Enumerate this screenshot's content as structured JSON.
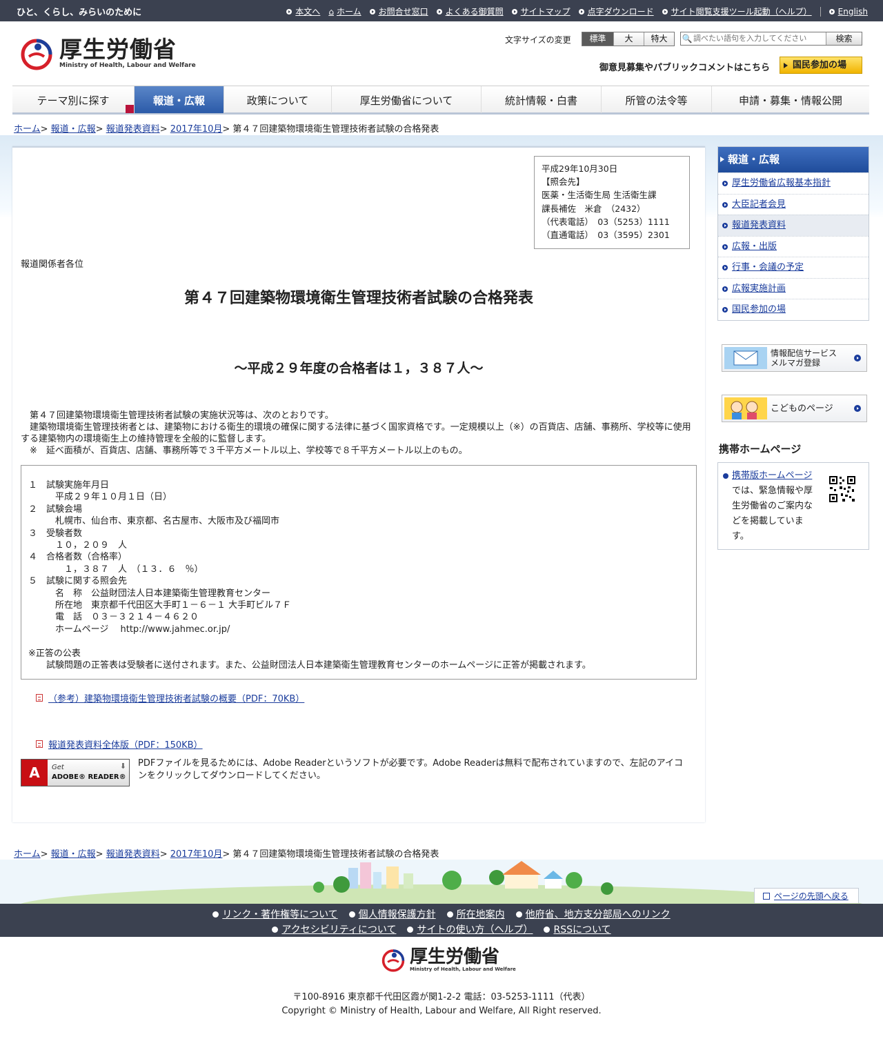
{
  "topbar": {
    "tagline": "ひと、くらし、みらいのために",
    "links": [
      "本文へ",
      "ホーム",
      "お問合せ窓口",
      "よくある御質問",
      "サイトマップ",
      "点字ダウンロード",
      "サイト閲覧支援ツール起動（ヘルプ）"
    ],
    "english": "English"
  },
  "header": {
    "logo_jp": "厚生労働省",
    "logo_en": "Ministry of Health, Labour and Welfare",
    "font_size_label": "文字サイズの変更",
    "font_sizes": [
      "標準",
      "大",
      "特大"
    ],
    "search_placeholder": "調べたい語句を入力してください",
    "search_button": "検索",
    "public_comment": "御意見募集やパブリックコメントはこちら",
    "participation_button": "国民参加の場"
  },
  "nav": {
    "tabs": [
      "テーマ別に探す",
      "報道・広報",
      "政策について",
      "厚生労働省について",
      "統計情報・白書",
      "所管の法令等",
      "申請・募集・情報公開"
    ]
  },
  "breadcrumb": {
    "items": [
      "ホーム",
      "報道・広報",
      "報道発表資料",
      "2017年10月"
    ],
    "current": "第４７回建築物環境衛生管理技術者試験の合格発表"
  },
  "contact": {
    "lines": [
      "平成29年10月30日",
      "【照会先】",
      "医薬・生活衛生局 生活衛生課",
      "課長補佐　米倉　（2432）",
      "（代表電話）　03（5253）1111",
      "（直通電話）　03（3595）2301"
    ]
  },
  "article": {
    "addressee": "報道関係者各位",
    "title": "第４７回建築物環境衛生管理技術者試験の合格発表",
    "subtitle": "～平成２９年度の合格者は１，３８７人～",
    "intro": [
      "第４７回建築物環境衛生管理技術者試験の実施状況等は、次のとおりです。",
      "建築物環境衛生管理技術者とは、建築物における衛生的環境の確保に関する法律に基づく国家資格です。一定規模以上（※）の百貨店、店舗、事務所、学校等に使用する建築物内の環境衛生上の維持管理を全般的に監督します。",
      "※　延べ面積が、百貨店、店舗、事務所等で３千平方メートル以上、学校等で８千平方メートル以上のもの。"
    ],
    "box_lines": [
      "１　試験実施年月日",
      "　　　平成２９年１０月１日（日）",
      "２　試験会場",
      "　　　札幌市、仙台市、東京都、名古屋市、大阪市及び福岡市",
      "３　受験者数",
      "　　　１０，２０９　人",
      "４　合格者数（合格率）",
      "　　　　１，３８７　人　（１３．６　％）",
      "５　試験に関する照会先",
      "　　　名　称　公益財団法人日本建築衛生管理教育センター",
      "　　　所在地　東京都千代田区大手町１－６－１ 大手町ビル７Ｆ",
      "　　　電　話　０３－３２１４－４６２０",
      "　　　ホームページ　 http://www.jahmec.or.jp/",
      "",
      "※正答の公表",
      "　　試験問題の正答表は受験者に送付されます。また、公益財団法人日本建築衛生管理教育センターのホームページに正答が掲載されます。"
    ],
    "pdf1": "（参考）建築物環境衛生管理技術者試験の概要（PDF：70KB）",
    "pdf2": "報道発表資料全体版（PDF：150KB）",
    "adobe_get": "Get",
    "adobe_reader": "ADOBE® READER®",
    "adobe_text": "PDFファイルを見るためには、Adobe Readerというソフトが必要です。Adobe Readerは無料で配布されていますので、左記のアイコンをクリックしてダウンロードしてください。"
  },
  "sidebar": {
    "head": "報道・広報",
    "items": [
      "厚生労働省広報基本指針",
      "大臣記者会見",
      "報道発表資料",
      "広報・出版",
      "行事・会議の予定",
      "広報実施計画",
      "国民参加の場"
    ],
    "banner_mail_1": "情報配信サービス",
    "banner_mail_2": "メルマガ登録",
    "banner_kids": "こどものページ",
    "mobile_title": "携帯ホームページ",
    "mobile_link": "携帯版ホームページ",
    "mobile_text": "では、緊急情報や厚生労働省のご案内などを掲載しています。"
  },
  "footer": {
    "to_top": "ページの先頭へ戻る",
    "row1": [
      "リンク・著作権等について",
      "個人情報保護方針",
      "所在地案内",
      "他府省、地方支分部局へのリンク"
    ],
    "row2": [
      "アクセシビリティについて",
      "サイトの使い方（ヘルプ）",
      "RSSについて"
    ],
    "logo_jp": "厚生労働省",
    "logo_en": "Ministry of Health, Labour and Welfare",
    "address": "〒100-8916 東京都千代田区霞が関1-2-2 電話：03-5253-1111（代表）",
    "copyright": "Copyright © Ministry of Health, Labour and Welfare, All Right reserved."
  }
}
